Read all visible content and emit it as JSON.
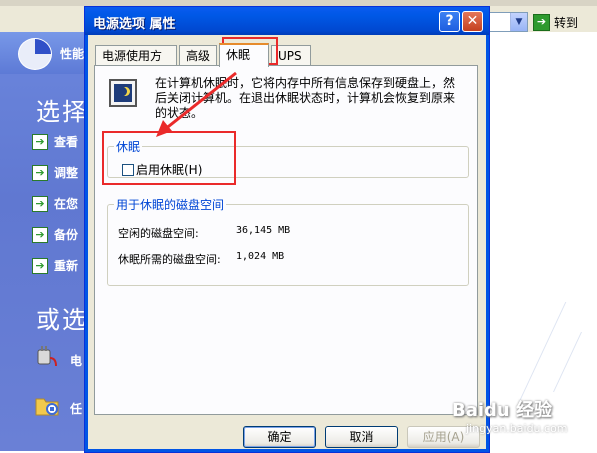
{
  "background": {
    "go_label": "转到",
    "heading1": "选择",
    "heading2": "或选",
    "panel_label": "性能",
    "tasks": [
      {
        "label": "查看"
      },
      {
        "label": "调整"
      },
      {
        "label": "在您"
      },
      {
        "label": "备份"
      },
      {
        "label": "重新"
      }
    ],
    "items": [
      {
        "label": "电"
      },
      {
        "label": "任"
      }
    ]
  },
  "dialog": {
    "title": "电源选项 属性",
    "help_glyph": "?",
    "close_glyph": "✕",
    "tabs": [
      {
        "label": "电源使用方案"
      },
      {
        "label": "高级"
      },
      {
        "label": "休眠"
      },
      {
        "label": "UPS"
      }
    ],
    "active_tab": "休眠",
    "description": "在计算机休眠时，它将内存中所有信息保存到硬盘上，然后关闭计算机。在退出休眠状态时，计算机会恢复到原来的状态。",
    "hibernate_group": {
      "legend": "休眠",
      "checkbox_label": "启用休眠(H)",
      "checked": false
    },
    "disk_group": {
      "legend": "用于休眠的磁盘空间",
      "free_label": "空闲的磁盘空间:",
      "free_value": "36,145 MB",
      "required_label": "休眠所需的磁盘空间:",
      "required_value": "1,024 MB"
    },
    "buttons": {
      "ok": "确定",
      "cancel": "取消",
      "apply": "应用(A)"
    }
  },
  "watermark": {
    "brand": "Baidu 经验",
    "url": "jingyan.baidu.com"
  },
  "colors": {
    "titlebar": "#0058e6",
    "annotation": "#ea2a2a",
    "group_legend": "#0046d5",
    "left_panel": "#6b86dd"
  }
}
